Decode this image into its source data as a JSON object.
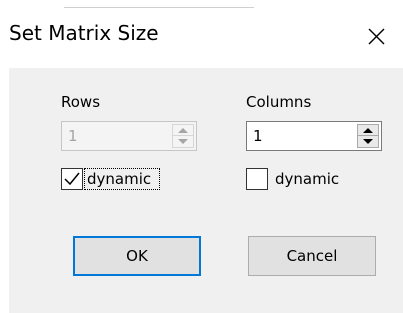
{
  "dialog": {
    "title": "Set Matrix Size",
    "close_icon": "close-icon"
  },
  "rows": {
    "label": "Rows",
    "value": "1",
    "enabled": false,
    "dynamic_label": "dynamic",
    "dynamic_checked": true
  },
  "columns": {
    "label": "Columns",
    "value": "1",
    "enabled": true,
    "dynamic_label": "dynamic",
    "dynamic_checked": false
  },
  "buttons": {
    "ok_label": "OK",
    "cancel_label": "Cancel"
  },
  "colors": {
    "accent": "#0078d7",
    "dialog_bg": "#f0f0f0"
  }
}
